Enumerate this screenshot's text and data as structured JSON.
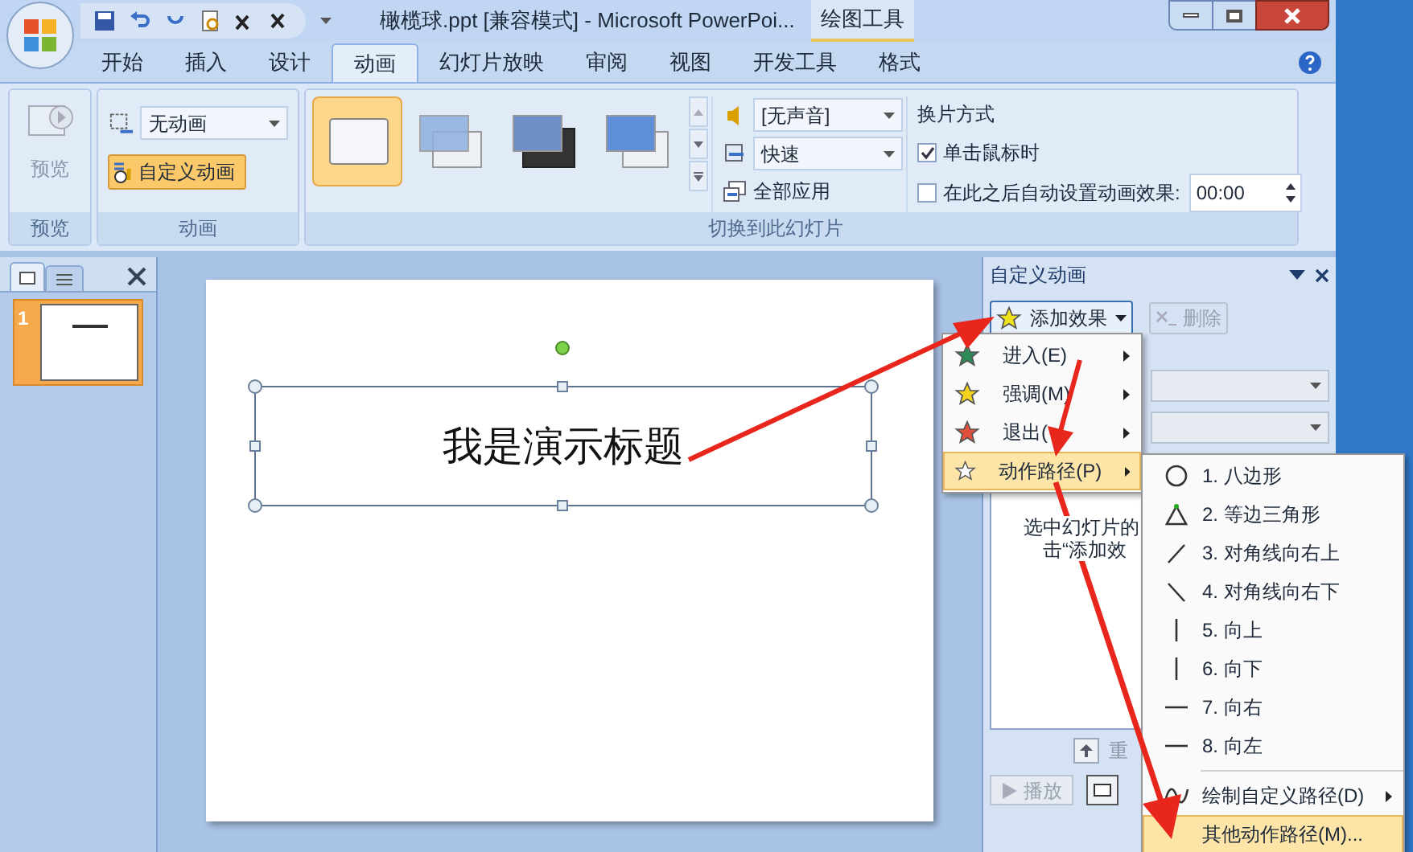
{
  "window": {
    "title": "橄榄球.ppt [兼容模式] - Microsoft PowerPoi...",
    "context_tab": "绘图工具"
  },
  "tabs": [
    {
      "label": "开始",
      "selected": false
    },
    {
      "label": "插入",
      "selected": false
    },
    {
      "label": "设计",
      "selected": false
    },
    {
      "label": "动画",
      "selected": true
    },
    {
      "label": "幻灯片放映",
      "selected": false
    },
    {
      "label": "审阅",
      "selected": false
    },
    {
      "label": "视图",
      "selected": false
    },
    {
      "label": "开发工具",
      "selected": false
    },
    {
      "label": "格式",
      "selected": false
    }
  ],
  "ribbon": {
    "preview": {
      "button": "预览",
      "group": "预览"
    },
    "animation": {
      "dropdown": "无动画",
      "custom_button": "自定义动画",
      "group": "动画"
    },
    "transitions": [
      {
        "kind": "none",
        "selected": true
      },
      {
        "kind": "fade",
        "selected": false
      },
      {
        "kind": "dark",
        "selected": false
      },
      {
        "kind": "push",
        "selected": false
      }
    ],
    "sound": "[无声音]",
    "speed": "快速",
    "apply_all": "全部应用",
    "transition_group": "切换到此幻灯片",
    "advance": {
      "title": "换片方式",
      "options": [
        {
          "label": "单击鼠标时",
          "checked": true
        },
        {
          "label": "在此之后自动设置动画效果:",
          "checked": false
        }
      ],
      "time": "00:00"
    }
  },
  "slides_panel": {
    "slides": [
      {
        "number": "1",
        "selected": true
      }
    ]
  },
  "slide": {
    "title": "我是演示标题"
  },
  "task_pane": {
    "title": "自定义动画",
    "add_effect": "添加效果",
    "remove": "删除",
    "hint_lines": [
      "选中幻灯片的",
      "击“添加效"
    ],
    "reorder": "重",
    "play": "播放"
  },
  "add_menu": [
    {
      "label": "进入(E)",
      "color": "#2e8b57",
      "selected": false
    },
    {
      "label": "强调(M)",
      "color": "#f2d21b",
      "selected": false
    },
    {
      "label": "退出(",
      "color": "#e0503c",
      "selected": false
    },
    {
      "label": "动作路径(P)",
      "color": "#ffffff",
      "selected": true
    }
  ],
  "path_menu": [
    {
      "kind": "octagon",
      "label": "1. 八边形",
      "selected": false
    },
    {
      "kind": "triangle",
      "label": "2. 等边三角形",
      "selected": false
    },
    {
      "kind": "diag-up",
      "label": "3. 对角线向右上",
      "selected": false
    },
    {
      "kind": "diag-down",
      "label": "4. 对角线向右下",
      "selected": false
    },
    {
      "kind": "vertical",
      "label": "5. 向上",
      "selected": false
    },
    {
      "kind": "vertical",
      "label": "6. 向下",
      "selected": false
    },
    {
      "kind": "horizontal",
      "label": "7. 向右",
      "selected": false
    },
    {
      "kind": "horizontal",
      "label": "8. 向左",
      "selected": false
    },
    {
      "kind": "custom",
      "label": "绘制自定义路径(D)",
      "selected": false
    },
    {
      "kind": "more",
      "label": "其他动作路径(M)...",
      "selected": true
    }
  ]
}
